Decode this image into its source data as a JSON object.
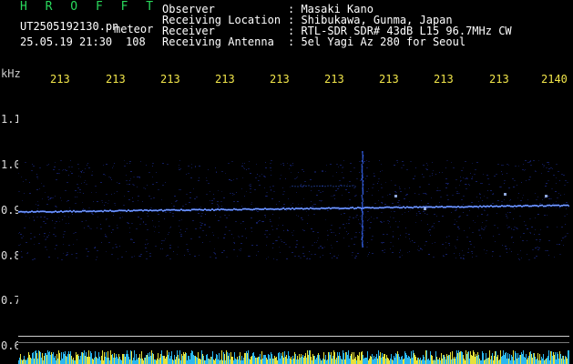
{
  "header": {
    "app_name": "H R O F F T",
    "filename": "UT2505192130.pn",
    "mode": "meteor",
    "datetime": "25.05.19 21:30",
    "count": "108",
    "info_labels": [
      "Observer",
      "Receiving Location",
      "Receiver",
      "Receiving Antenna"
    ],
    "info_values": [
      ": Masaki Kano",
      ": Shibukawa, Gunma, Japan",
      ": RTL-SDR SDR# 43dB L15 96.7MHz CW",
      ": 5el Yagi Az 280 for Seoul"
    ]
  },
  "spectrogram": {
    "y_unit": "kHz",
    "y_ticks": [
      "1.1",
      "1.0",
      "0.9",
      "0.8",
      "0.7",
      "0.6"
    ],
    "x_ticks": [
      "213",
      "213",
      "213",
      "213",
      "213",
      "213",
      "213",
      "213",
      "213",
      "2140"
    ],
    "colors": {
      "background": "#000000",
      "signal": "#3a6bff",
      "signal_core": "#a9c4ff",
      "axis_text": "#f2e64a",
      "app_name": "#29d95c"
    }
  }
}
